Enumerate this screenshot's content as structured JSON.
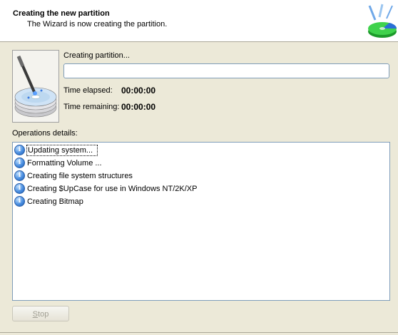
{
  "header": {
    "title": "Creating the new partition",
    "subtitle": "The Wizard is now creating the partition."
  },
  "status": {
    "creating_label": "Creating partition...",
    "progress_percent": 0,
    "time_elapsed_label": "Time elapsed:",
    "time_elapsed_value": "00:00:00",
    "time_remaining_label": "Time remaining:",
    "time_remaining_value": "00:00:00"
  },
  "operations": {
    "label": "Operations details:",
    "items": [
      {
        "text": "Updating system...",
        "icon": "info-icon"
      },
      {
        "text": "Formatting Volume ...",
        "icon": "info-icon"
      },
      {
        "text": "Creating file system structures",
        "icon": "info-icon"
      },
      {
        "text": "Creating $UpCase for use in Windows NT/2K/XP",
        "icon": "info-icon"
      },
      {
        "text": "Creating Bitmap",
        "icon": "info-icon"
      }
    ]
  },
  "buttons": {
    "stop_prefix": "S",
    "stop_rest": "top"
  },
  "colors": {
    "window_bg": "#ece9d8",
    "header_bg": "#ffffff",
    "info_icon": "#4a8ee0",
    "border": "#7f9db9"
  }
}
